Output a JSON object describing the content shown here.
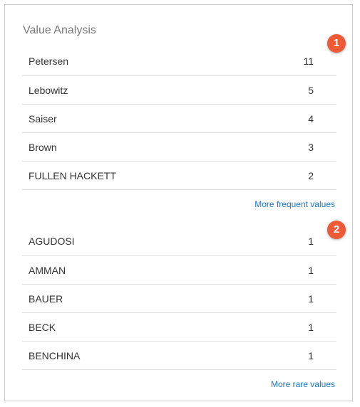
{
  "panel": {
    "title": "Value Analysis"
  },
  "frequent": {
    "items": [
      {
        "name": "Petersen",
        "count": "11"
      },
      {
        "name": "Lebowitz",
        "count": "5"
      },
      {
        "name": "Saiser",
        "count": "4"
      },
      {
        "name": "Brown",
        "count": "3"
      },
      {
        "name": "FULLEN HACKETT",
        "count": "2"
      }
    ],
    "more_label": "More frequent values"
  },
  "rare": {
    "items": [
      {
        "name": "AGUDOSI",
        "count": "1"
      },
      {
        "name": "AMMAN",
        "count": "1"
      },
      {
        "name": "BAUER",
        "count": "1"
      },
      {
        "name": "BECK",
        "count": "1"
      },
      {
        "name": "BENCHINA",
        "count": "1"
      }
    ],
    "more_label": "More rare values"
  },
  "badges": {
    "first": "1",
    "second": "2"
  },
  "colors": {
    "badge": "#ee5a35",
    "link": "#1a73c8"
  }
}
